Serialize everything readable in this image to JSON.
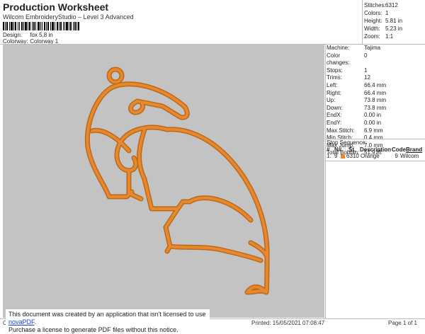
{
  "header": {
    "title": "Production Worksheet",
    "subtitle": "Wilcom EmbroideryStudio – Level 3 Advanced",
    "design_label": "Design:",
    "design_value": "fox 5,8 in",
    "colorway_label": "Colorway:",
    "colorway_value": "Colorway 1"
  },
  "stats": [
    {
      "label": "Stitches:",
      "value": "6312"
    },
    {
      "label": "Colors:",
      "value": "1"
    },
    {
      "label": "Height:",
      "value": "5.81 in"
    },
    {
      "label": "Width:",
      "value": "5.23 in"
    },
    {
      "label": "Zoom:",
      "value": "1:1"
    }
  ],
  "properties": [
    {
      "label": "Machine:",
      "value": "Tajima"
    },
    {
      "label": "Color changes:",
      "value": "0"
    },
    {
      "label": "Stops:",
      "value": "1"
    },
    {
      "label": "Trims:",
      "value": "12"
    },
    {
      "label": "Left:",
      "value": "66.4 mm"
    },
    {
      "label": "Right:",
      "value": "66.4 mm"
    },
    {
      "label": "Up:",
      "value": "73.8 mm"
    },
    {
      "label": "Down:",
      "value": "73.8 mm"
    },
    {
      "label": "EndX:",
      "value": "0.00 in"
    },
    {
      "label": "EndY:",
      "value": "0.00 in"
    },
    {
      "label": "Max Stitch:",
      "value": "6.9 mm"
    },
    {
      "label": "Min Stitch:",
      "value": "0.4 mm"
    },
    {
      "label": "Max Jump:",
      "value": "7.0 mm"
    },
    {
      "label": "Total Bobbin:",
      "value": "51.91ft"
    }
  ],
  "stop_sequence": {
    "title": "Stop Sequence:",
    "headers": [
      "#",
      "N#",
      "St.",
      "Description",
      "Code",
      "Brand"
    ],
    "rows": [
      {
        "num": "1.",
        "n": "9",
        "st": "6310",
        "desc": "Orange",
        "code": "9",
        "brand": "Wilcom",
        "color": "#e8872c"
      }
    ]
  },
  "notice": {
    "line1_prefix": "This document was created by an application that isn't licensed to use ",
    "link": "novaPDF",
    "line1_suffix": ".",
    "line2": "Purchase a license to generate PDF files without this notice."
  },
  "footer": {
    "left": "Cr",
    "printed": "Printed: 15/05/2021 07:08:47",
    "page": "Page 1 of 1"
  },
  "colors": {
    "thread": "#e8872c",
    "canvas": "#c3c3c3"
  }
}
